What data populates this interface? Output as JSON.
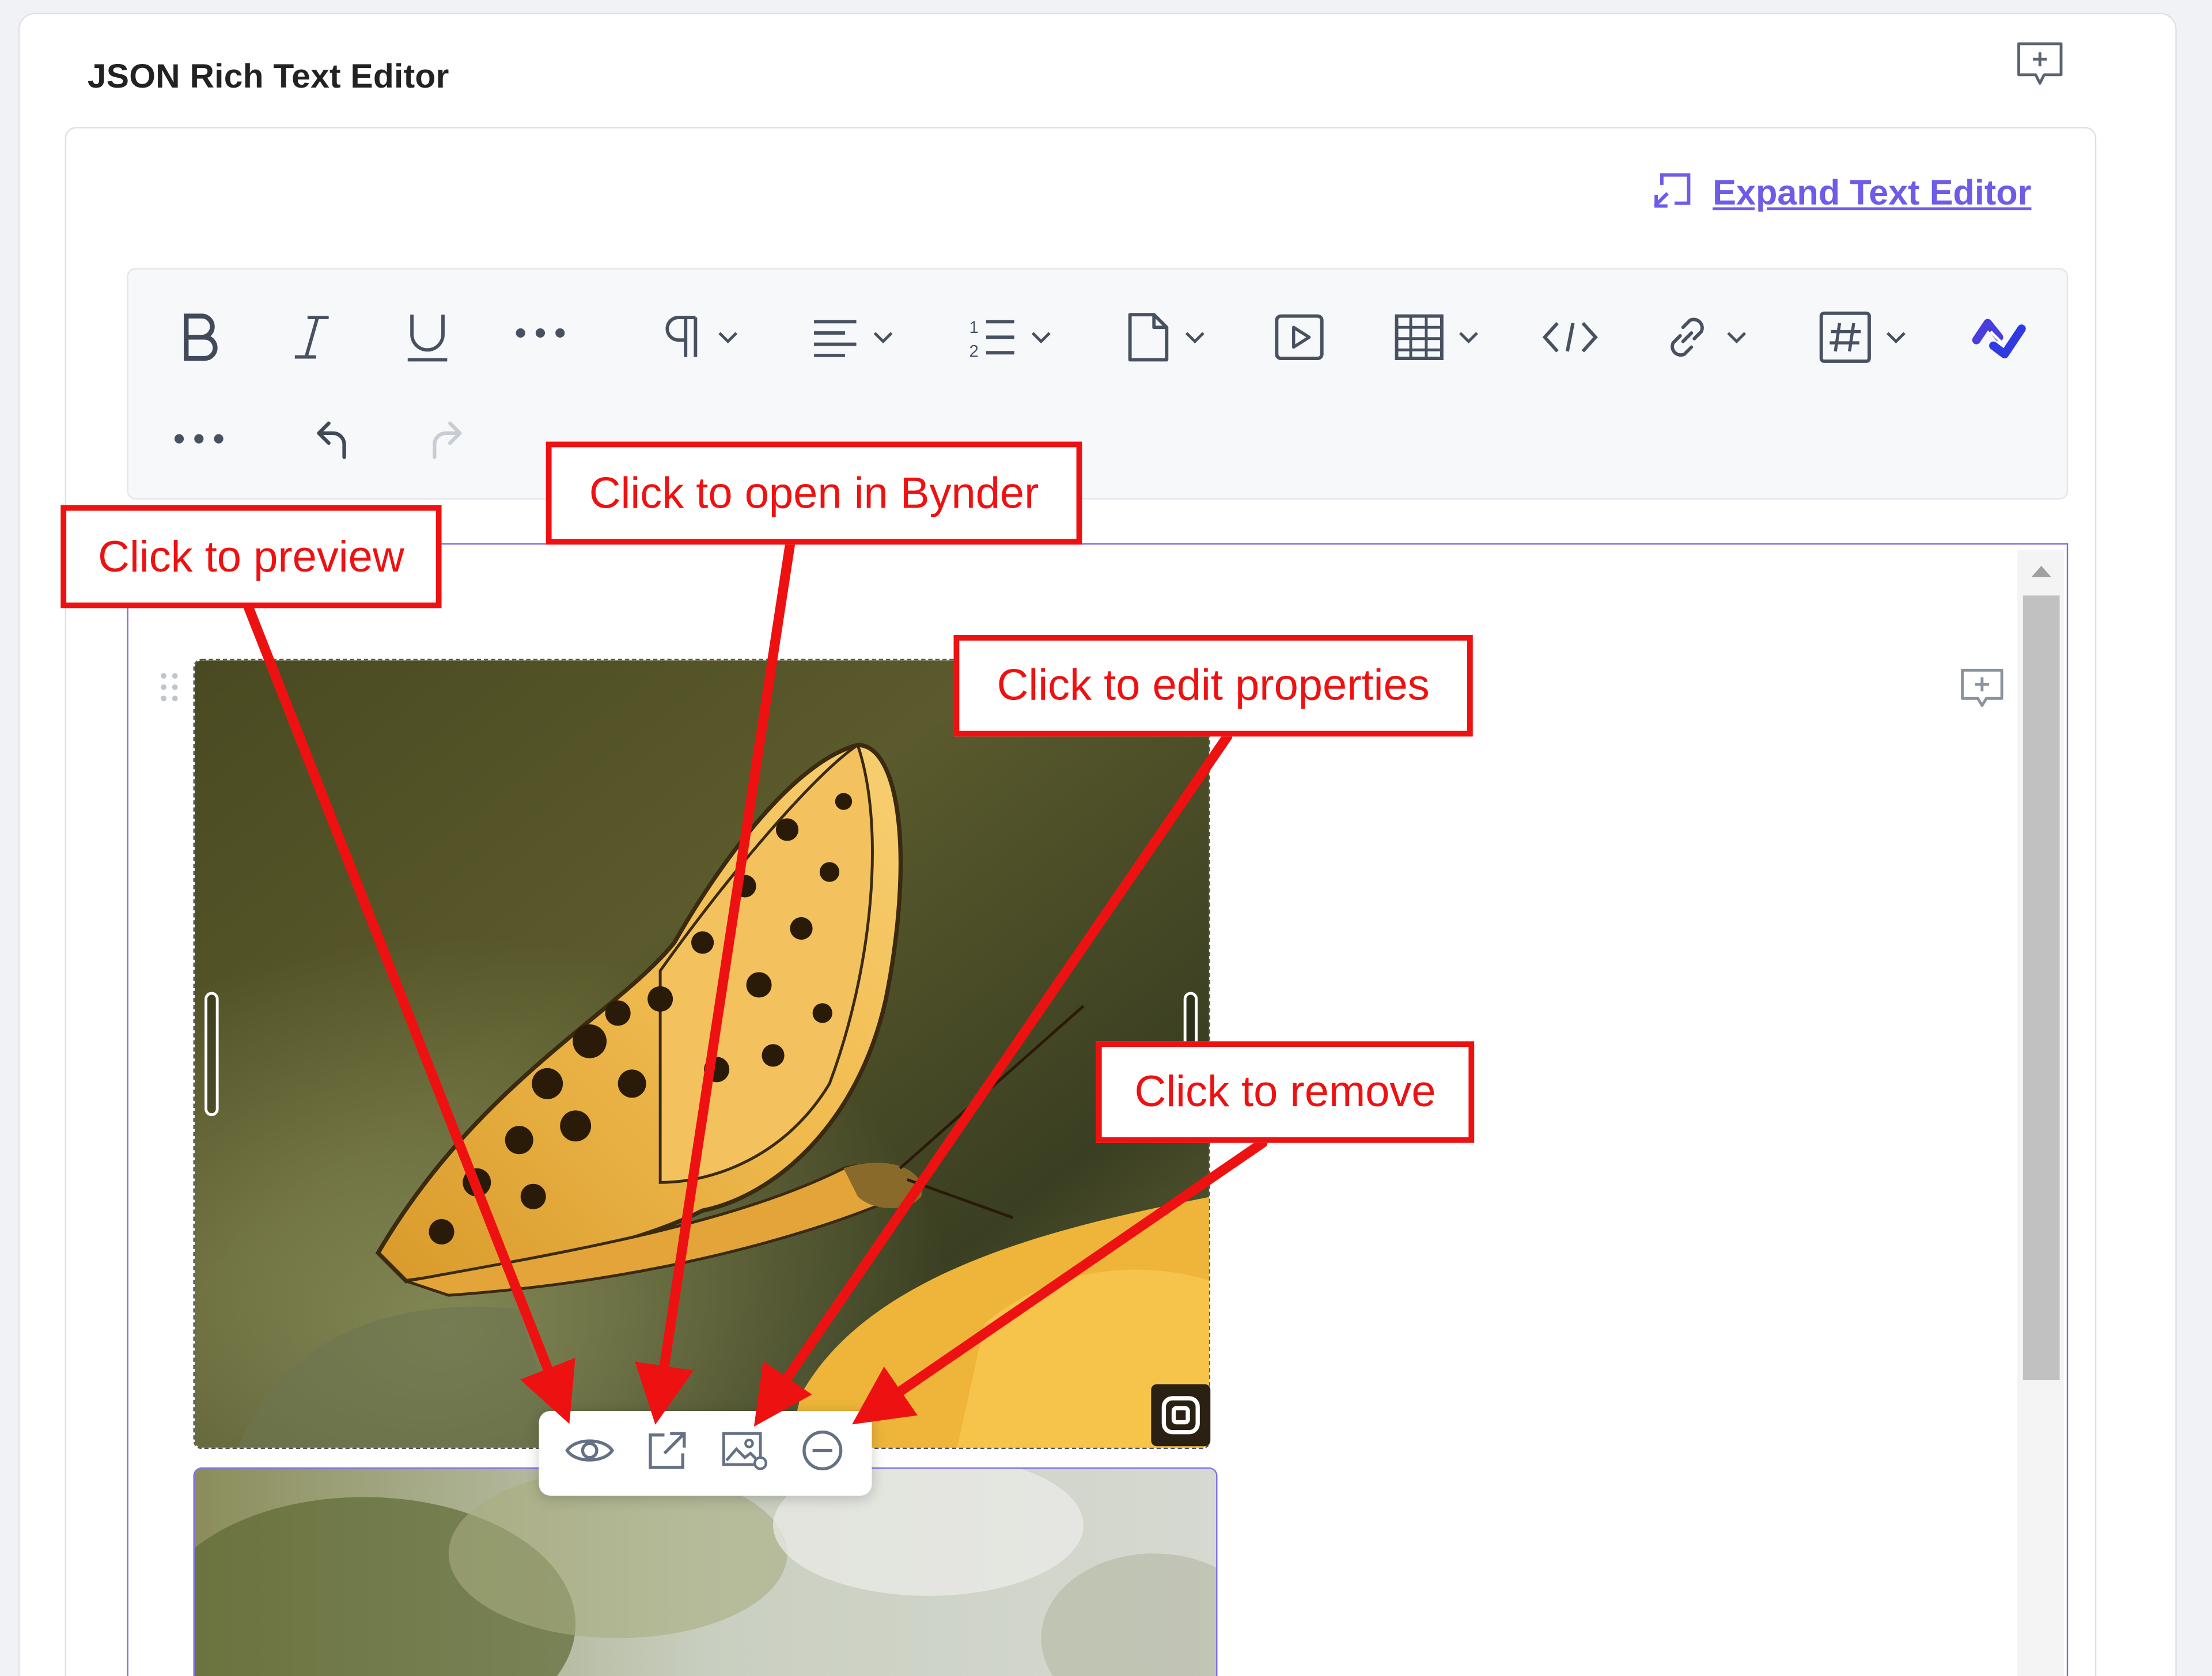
{
  "field": {
    "title": "JSON Rich Text Editor"
  },
  "editor": {
    "expand_label": "Expand Text Editor"
  },
  "toolbar": {
    "row1": [
      "bold-icon",
      "italic-icon",
      "underline-icon",
      "more-icon",
      "paragraph-icon",
      "align-icon",
      "list-icon",
      "insert-icon",
      "video-icon",
      "table-icon",
      "code-icon",
      "link-icon",
      "hashtag-icon",
      "plugin-icon"
    ],
    "row2": [
      "more-icon",
      "undo-icon",
      "redo-icon"
    ]
  },
  "image_toolbar": [
    "eye-icon",
    "open-external-icon",
    "image-settings-icon",
    "remove-icon"
  ],
  "annotations": {
    "preview": "Click to preview",
    "open_bynder": "Click to open in Bynder",
    "edit_properties": "Click to edit properties",
    "remove": "Click to remove"
  },
  "colors": {
    "accent": "#6c5ce7",
    "annotation": "#ee1111",
    "border": "#dfe1e6"
  }
}
